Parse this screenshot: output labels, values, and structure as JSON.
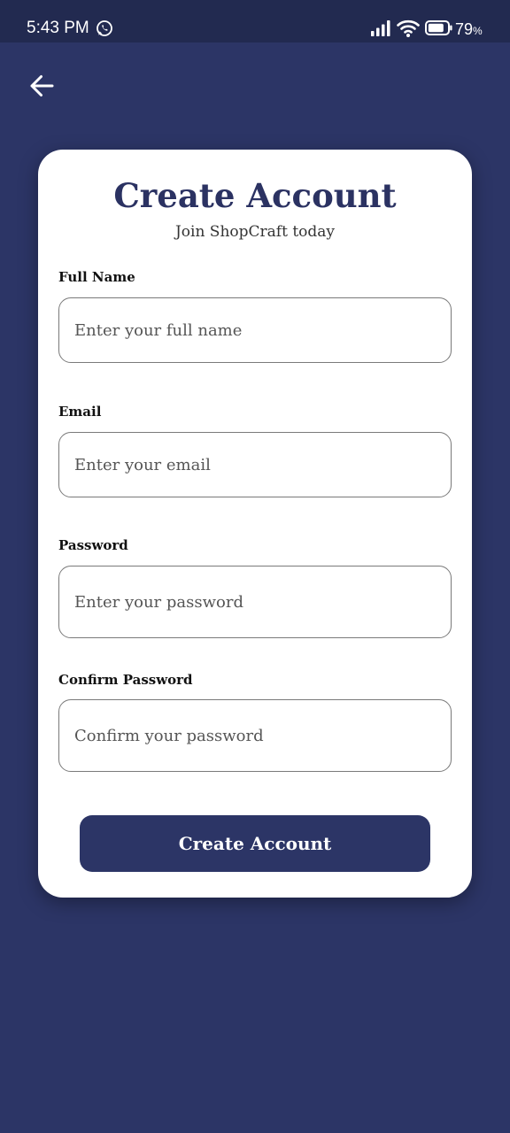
{
  "status_bar": {
    "time": "5:43 PM",
    "battery_level": "79",
    "battery_unit": "%",
    "icons": [
      "whatsapp-icon",
      "signal-icon",
      "wifi-icon",
      "battery-icon"
    ]
  },
  "nav": {
    "back_icon": "arrow-left-icon"
  },
  "form": {
    "title": "Create Account",
    "subtitle": "Join ShopCraft today",
    "fields": [
      {
        "label": "Full Name",
        "placeholder": "Enter your full name",
        "value": ""
      },
      {
        "label": "Email",
        "placeholder": "Enter your email",
        "value": ""
      },
      {
        "label": "Password",
        "placeholder": "Enter your password",
        "value": ""
      },
      {
        "label": "Confirm Password",
        "placeholder": "Confirm your password",
        "value": ""
      }
    ],
    "submit_label": "Create Account"
  },
  "colors": {
    "background": "#2c3566",
    "status_bar": "#222a50",
    "card": "#ffffff",
    "accent": "#2b3262",
    "input_border": "#7a7a7a"
  }
}
